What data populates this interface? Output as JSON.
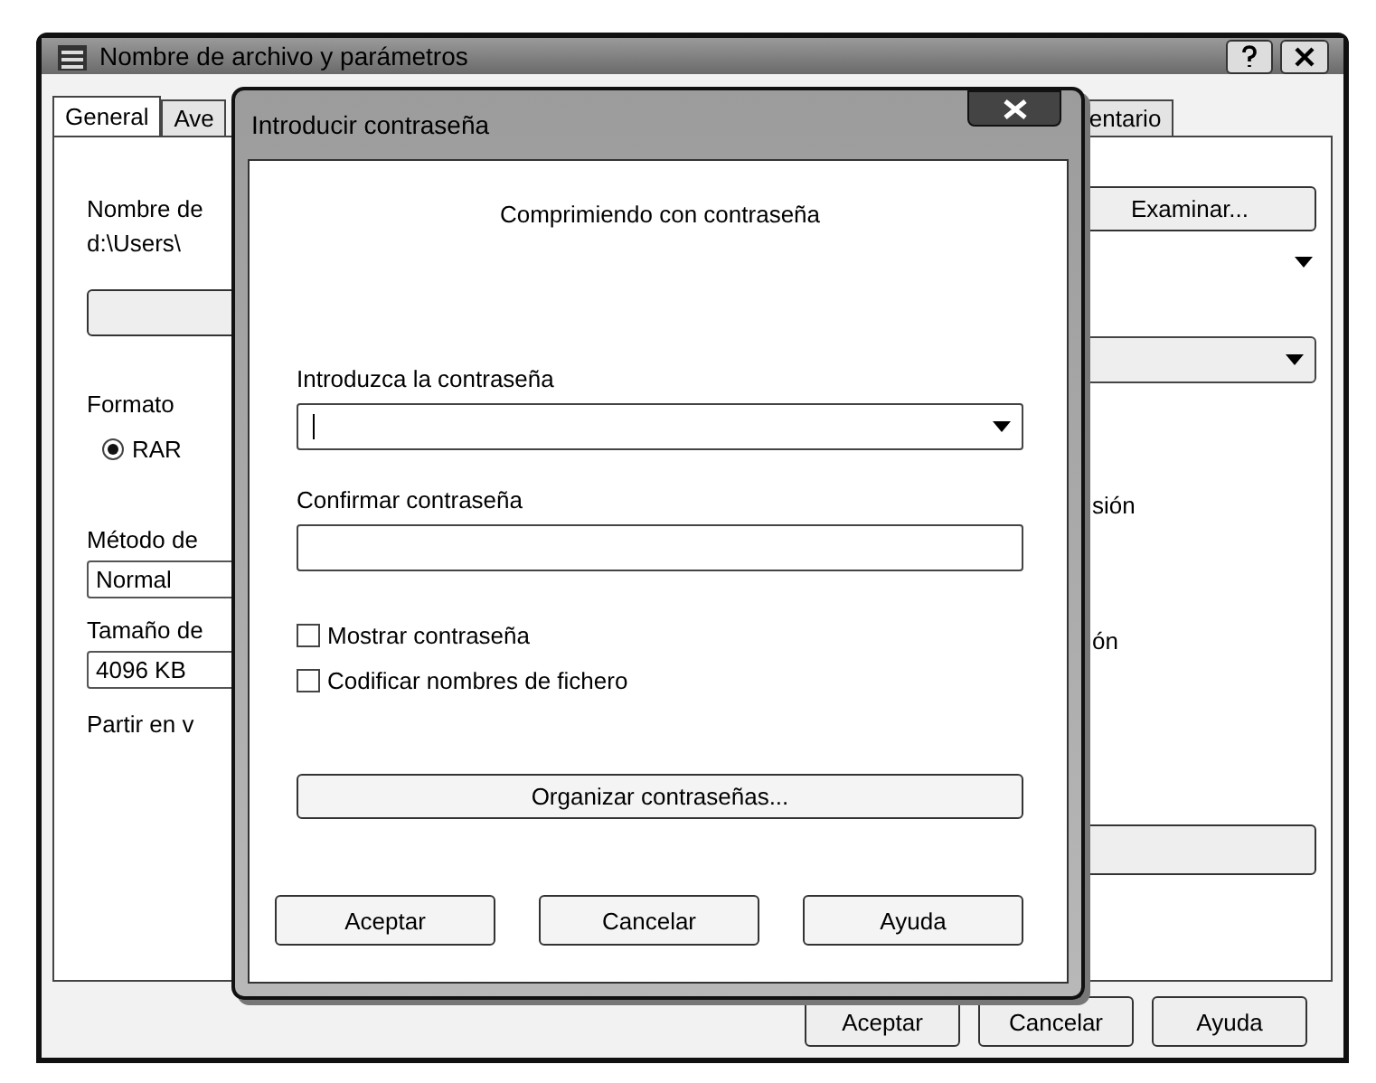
{
  "main_window": {
    "title": "Nombre de archivo y parámetros",
    "tabs": [
      {
        "label": "General",
        "selected": true
      },
      {
        "label": "Ave",
        "selected": false
      },
      {
        "label": "entario",
        "selected": false
      }
    ],
    "archive_name_label": "Nombre de",
    "archive_path": "d:\\Users\\",
    "browse_button": "Examinar...",
    "format_label": "Formato",
    "format_options": [
      {
        "label": "RAR",
        "selected": true
      }
    ],
    "method_label": "Método de",
    "method_value": "Normal",
    "dictionary_label": "Tamaño de",
    "dictionary_value": "4096 KB",
    "split_label": "Partir en v",
    "right_fragments": [
      "sión",
      "ón"
    ],
    "buttons": [
      "Aceptar",
      "Cancelar",
      "Ayuda"
    ]
  },
  "password_dialog": {
    "title": "Introducir contraseña",
    "heading": "Comprimiendo con contraseña",
    "password_label": "Introduzca la contraseña",
    "confirm_label": "Confirmar contraseña",
    "options": [
      {
        "label": "Mostrar contraseña",
        "checked": false
      },
      {
        "label": "Codificar nombres de fichero",
        "checked": false
      }
    ],
    "organize_button": "Organizar contraseñas...",
    "buttons": [
      "Aceptar",
      "Cancelar",
      "Ayuda"
    ]
  }
}
